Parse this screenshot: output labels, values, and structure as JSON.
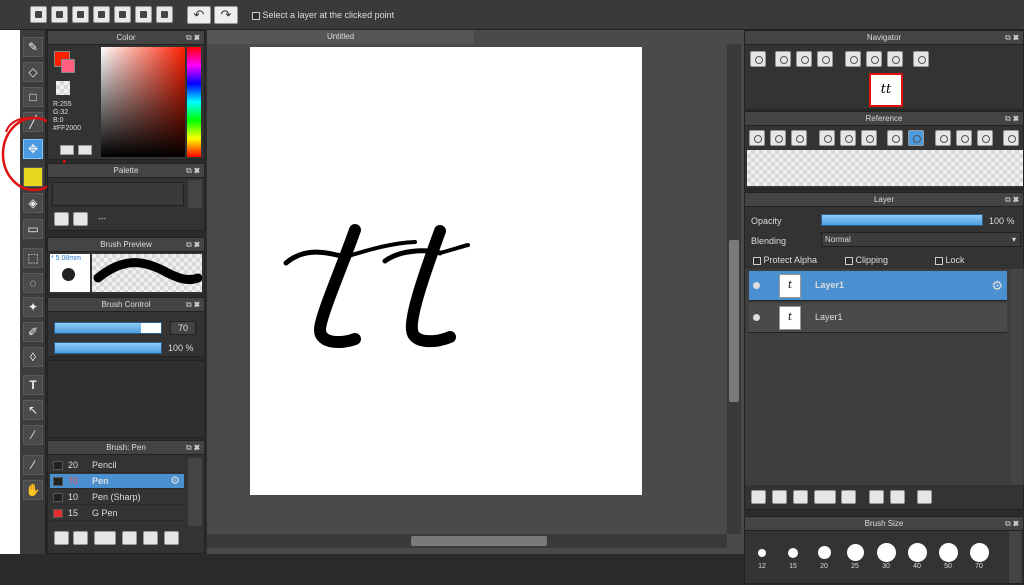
{
  "topbar": {
    "select_layer_label": "Select a layer at the clicked point",
    "undo_label": "↶",
    "redo_label": "↷"
  },
  "color_panel": {
    "title": "Color",
    "r": "R:255",
    "g": "G:32",
    "b": "B:0",
    "hex": "#FF2000",
    "accent": "#FF2000"
  },
  "palette_panel": {
    "title": "Palette",
    "name": "---"
  },
  "brush_preview": {
    "title": "Brush Preview",
    "size": "* 5.08mm"
  },
  "brush_control": {
    "title": "Brush Control",
    "size_value": "70",
    "opacity_value": "100 %"
  },
  "brush_list": {
    "title": "Brush: Pen",
    "items": [
      {
        "size": "20",
        "name": "Pencil",
        "swatch": "#222222"
      },
      {
        "size": "70",
        "name": "Pen",
        "swatch": "#222222"
      },
      {
        "size": "10",
        "name": "Pen (Sharp)",
        "swatch": "#222222"
      },
      {
        "size": "15",
        "name": "G Pen",
        "swatch": "#e03030"
      }
    ]
  },
  "document": {
    "tab_title": "Untitled",
    "canvas_text": "tt"
  },
  "navigator": {
    "title": "Navigator",
    "thumb_text": "tt"
  },
  "reference": {
    "title": "Reference"
  },
  "layer_panel": {
    "title": "Layer",
    "opacity_label": "Opacity",
    "opacity_value": "100 %",
    "blending_label": "Blending",
    "blending_value": "Normal",
    "protect_alpha": "Protect Alpha",
    "clipping": "Clipping",
    "lock": "Lock",
    "layers": [
      {
        "name": "Layer1",
        "thumb": "t"
      },
      {
        "name": "Layer1",
        "thumb": "t"
      }
    ]
  },
  "brush_size": {
    "title": "Brush Size",
    "sizes": [
      "12",
      "15",
      "20",
      "25",
      "30",
      "40",
      "50",
      "70"
    ]
  },
  "icons": {
    "gear": "⚙",
    "close": "✖",
    "popout": "⧉",
    "text_tool": "T",
    "hand": "✋",
    "move": "✥"
  }
}
